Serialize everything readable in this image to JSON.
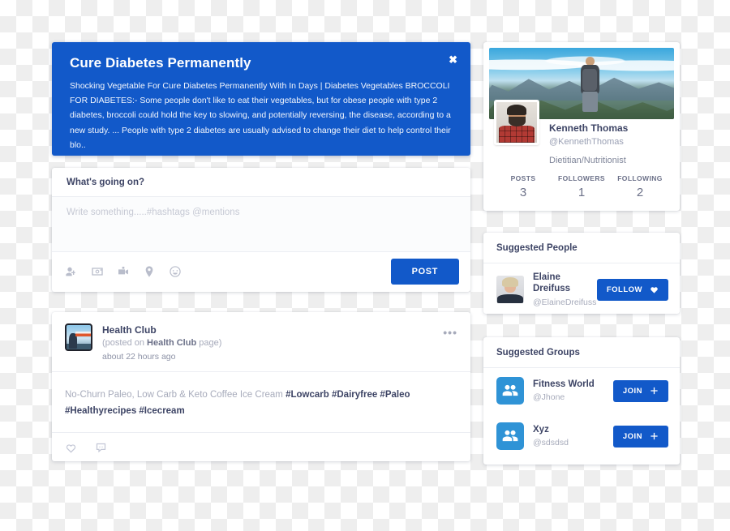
{
  "banner": {
    "title": "Cure Diabetes Permanently",
    "body": "Shocking Vegetable For Cure Diabetes Permanently With In Days | Diabetes Vegetables BROCCOLI FOR DIABETES:- Some people don't like to eat their vegetables, but for obese people with type 2 diabetes, broccoli could hold the key to slowing, and potentially reversing, the disease, according to a new study. ... People with type 2 diabetes are usually advised to change their diet to help control their blo..",
    "close_label": "✖",
    "background_color": "#1259c9"
  },
  "compose": {
    "heading": "What's going on?",
    "placeholder": "Write something.....#hashtags @mentions",
    "value": "",
    "post_label": "POST",
    "post_color": "#1259c9",
    "icons": [
      {
        "name": "tag-people-icon"
      },
      {
        "name": "photo-camera-icon"
      },
      {
        "name": "video-camera-icon"
      },
      {
        "name": "location-pin-icon"
      },
      {
        "name": "emoji-smiley-icon"
      }
    ]
  },
  "post": {
    "author": "Health Club",
    "posted_on_prefix": "(posted on ",
    "posted_on_page": "Health Club",
    "posted_on_suffix": " page)",
    "time": "about 22 hours ago",
    "menu_label": "•••",
    "text": "No-Churn Paleo, Low Carb & Keto Coffee Ice Cream ",
    "hashtags": "#Lowcarb #Dairyfree #Paleo #Healthyrecipes #Icecream",
    "actions": [
      {
        "name": "like-heart-icon"
      },
      {
        "name": "comment-bubble-icon"
      }
    ]
  },
  "profile": {
    "name": "Kenneth Thomas",
    "handle": "@KennethThomas",
    "role": "Dietitian/Nutritionist",
    "stats": [
      {
        "label": "POSTS",
        "value": "3"
      },
      {
        "label": "FOLLOWERS",
        "value": "1"
      },
      {
        "label": "FOLLOWING",
        "value": "2"
      }
    ]
  },
  "suggested_people": {
    "heading": "Suggested People",
    "items": [
      {
        "name": "Elaine Dreifuss",
        "handle": "@ElaineDreifuss",
        "action_label": "FOLLOW",
        "action_icon": "heart-icon"
      }
    ]
  },
  "suggested_groups": {
    "heading": "Suggested Groups",
    "items": [
      {
        "name": "Fitness World",
        "handle": "@Jhone",
        "action_label": "JOIN",
        "action_icon": "plus-icon"
      },
      {
        "name": "Xyz",
        "handle": "@sdsdsd",
        "action_label": "JOIN",
        "action_icon": "plus-icon"
      }
    ]
  }
}
